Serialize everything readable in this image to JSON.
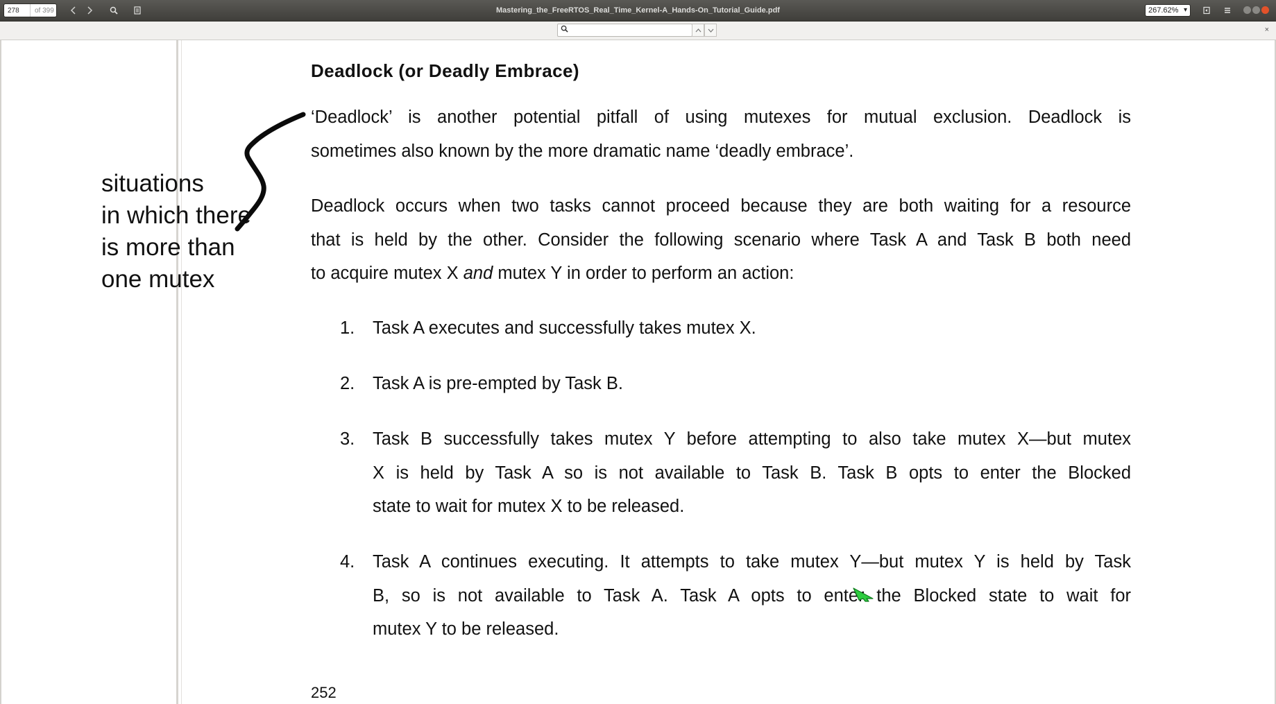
{
  "toolbar": {
    "current_page": "278",
    "page_count": "of 399",
    "document_title": "Mastering_the_FreeRTOS_Real_Time_Kernel-A_Hands-On_Tutorial_Guide.pdf",
    "zoom": "267.62%"
  },
  "findbar": {
    "query": "",
    "close_glyph": "×"
  },
  "page": {
    "heading": "Deadlock (or Deadly Embrace)",
    "para1_line1": "‘Deadlock’ is another potential pitfall of using mutexes for mutual exclusion.  Deadlock is",
    "para1_line2": "sometimes also known by the more dramatic name ‘deadly embrace’.",
    "para2_line1": "Deadlock occurs when two tasks cannot proceed because they are both waiting for a resource",
    "para2_line2": "that is held by the other.  Consider the following scenario where Task A and Task B both need",
    "para2_line3_pre": "to acquire mutex X ",
    "para2_line3_em": "and",
    "para2_line3_post": " mutex Y in order to perform an action:",
    "list": [
      {
        "num": "1.",
        "lines": [
          "Task A executes and successfully takes mutex X."
        ]
      },
      {
        "num": "2.",
        "lines": [
          "Task A is pre-empted by Task B."
        ]
      },
      {
        "num": "3.",
        "lines": [
          "Task B successfully takes mutex Y before attempting to also take mutex X—but mutex",
          "X is held by Task A so is not available to Task B.  Task B opts to enter the Blocked",
          "state to wait for mutex X to be released."
        ]
      },
      {
        "num": "4.",
        "lines": [
          "Task A continues executing.  It attempts to take mutex Y—but mutex Y is held by Task",
          "B, so is not available to Task A.  Task A opts to enter the Blocked state to wait for",
          "mutex Y to be released."
        ]
      }
    ],
    "page_number": "252"
  },
  "annotation": {
    "lines": [
      "situations",
      "in which there",
      "is more than",
      "one mutex"
    ]
  },
  "colors": {
    "toolbar_bg": "#4a4945",
    "close_button": "#e2522a",
    "minimize_button": "#8a8985",
    "maximize_button": "#8a8985",
    "cursor": "#2ecc40"
  },
  "icons": {
    "nav_prev": "chevron-left-icon",
    "nav_next": "chevron-right-icon",
    "search": "search-icon",
    "sidebar": "document-icon",
    "presentation": "presentation-icon",
    "menu": "hamburger-menu-icon"
  }
}
